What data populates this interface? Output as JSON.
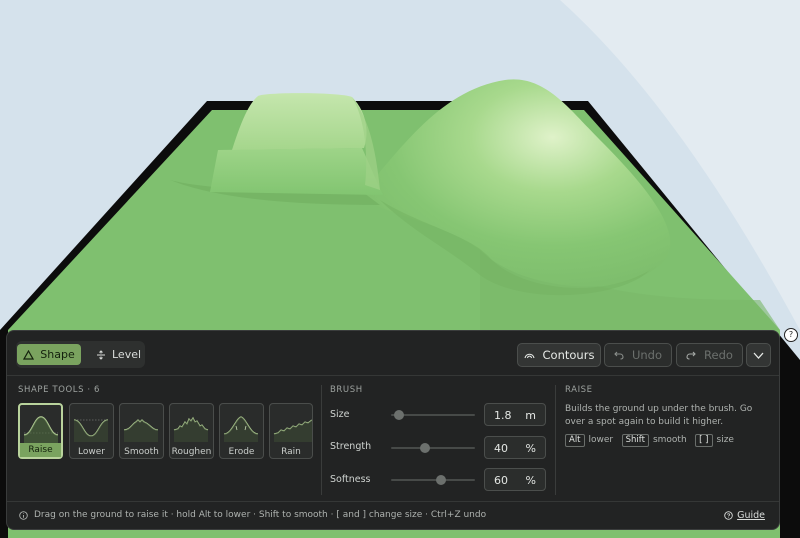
{
  "mode_tabs": [
    {
      "label": "Shape",
      "icon": "triangle-icon",
      "active": true
    },
    {
      "label": "Level",
      "icon": "level-icon",
      "active": false
    }
  ],
  "toolbar": {
    "contours": "Contours",
    "undo": "Undo",
    "redo": "Redo"
  },
  "shape_tools": {
    "heading": "SHAPE TOOLS · 6",
    "items": [
      {
        "label": "Raise",
        "selected": true
      },
      {
        "label": "Lower"
      },
      {
        "label": "Smooth"
      },
      {
        "label": "Roughen"
      },
      {
        "label": "Erode"
      },
      {
        "label": "Rain"
      }
    ]
  },
  "brush": {
    "heading": "BRUSH",
    "size": {
      "label": "Size",
      "value": "1.8",
      "unit": "m",
      "level": 0.1
    },
    "strength": {
      "label": "Strength",
      "value": "40",
      "unit": "%",
      "level": 0.4
    },
    "softness": {
      "label": "Softness",
      "value": "60",
      "unit": "%",
      "level": 0.6
    }
  },
  "info": {
    "heading": "RAISE",
    "description": "Builds the ground up under the brush. Go over a spot again to build it higher.",
    "keys": [
      {
        "key": "Alt",
        "text": "lower"
      },
      {
        "key": "Shift",
        "text": "smooth"
      },
      {
        "key": "[ ]",
        "text": "size"
      }
    ]
  },
  "footer": {
    "hint": "Drag on the ground to raise it · hold Alt to lower · Shift to smooth · [ and ] change size · Ctrl+Z undo",
    "guide": "Guide"
  },
  "colors": {
    "accent": "#7aa35f",
    "terrain": "#7fc06f",
    "panel": "#222323",
    "sky": "#d5e2ec"
  }
}
